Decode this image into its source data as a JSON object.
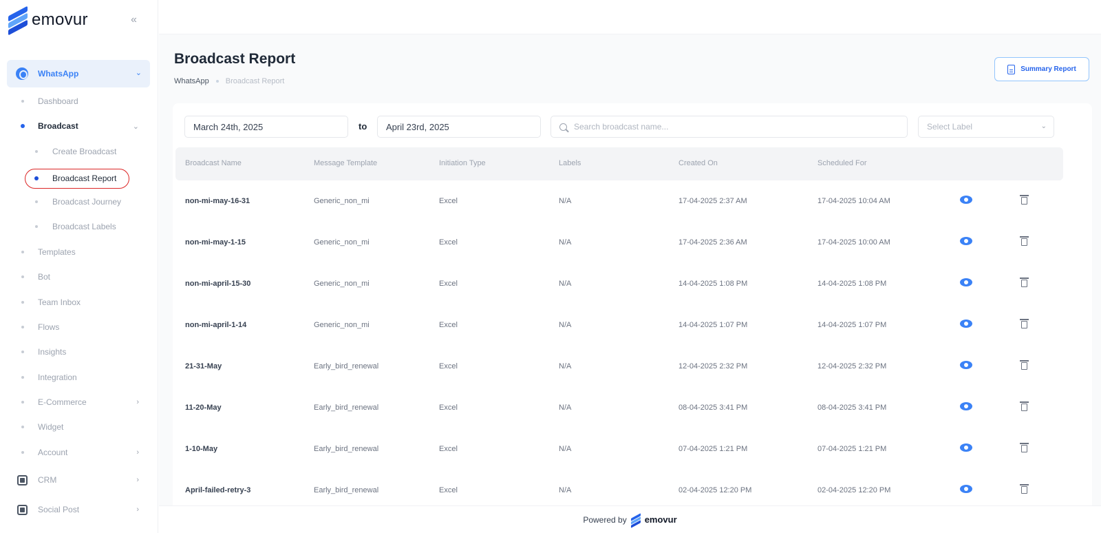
{
  "brand": {
    "name": "emovur"
  },
  "sidebar": {
    "group": {
      "label": "WhatsApp",
      "icon": "whatsapp-icon"
    },
    "items": [
      {
        "label": "Dashboard"
      },
      {
        "label": "Broadcast"
      },
      {
        "label": "Create Broadcast"
      },
      {
        "label": "Broadcast Report"
      },
      {
        "label": "Broadcast Journey"
      },
      {
        "label": "Broadcast Labels"
      },
      {
        "label": "Templates"
      },
      {
        "label": "Bot"
      },
      {
        "label": "Team Inbox"
      },
      {
        "label": "Flows"
      },
      {
        "label": "Insights"
      },
      {
        "label": "Integration"
      },
      {
        "label": "E-Commerce"
      },
      {
        "label": "Widget"
      },
      {
        "label": "Account"
      },
      {
        "label": "CRM"
      },
      {
        "label": "Social Post"
      }
    ],
    "active_item": "Broadcast Report"
  },
  "header": {
    "title": "Broadcast Report",
    "breadcrumb": [
      "WhatsApp",
      "Broadcast Report"
    ],
    "summary_button": "Summary Report"
  },
  "filters": {
    "date_from": "March 24th, 2025",
    "to_label": "to",
    "date_to": "April 23rd, 2025",
    "search_placeholder": "Search broadcast name...",
    "label_placeholder": "Select Label"
  },
  "table": {
    "columns": [
      "Broadcast Name",
      "Message Template",
      "Initiation Type",
      "Labels",
      "Created On",
      "Scheduled For"
    ],
    "rows": [
      [
        "non-mi-may-16-31",
        "Generic_non_mi",
        "Excel",
        "N/A",
        "17-04-2025 2:37 AM",
        "17-04-2025 10:04 AM"
      ],
      [
        "non-mi-may-1-15",
        "Generic_non_mi",
        "Excel",
        "N/A",
        "17-04-2025 2:36 AM",
        "17-04-2025 10:00 AM"
      ],
      [
        "non-mi-april-15-30",
        "Generic_non_mi",
        "Excel",
        "N/A",
        "14-04-2025 1:08 PM",
        "14-04-2025 1:08 PM"
      ],
      [
        "non-mi-april-1-14",
        "Generic_non_mi",
        "Excel",
        "N/A",
        "14-04-2025 1:07 PM",
        "14-04-2025 1:07 PM"
      ],
      [
        "21-31-May",
        "Early_bird_renewal",
        "Excel",
        "N/A",
        "12-04-2025 2:32 PM",
        "12-04-2025 2:32 PM"
      ],
      [
        "11-20-May",
        "Early_bird_renewal",
        "Excel",
        "N/A",
        "08-04-2025 3:41 PM",
        "08-04-2025 3:41 PM"
      ],
      [
        "1-10-May",
        "Early_bird_renewal",
        "Excel",
        "N/A",
        "07-04-2025 1:21 PM",
        "07-04-2025 1:21 PM"
      ],
      [
        "April-failed-retry-3",
        "Early_bird_renewal",
        "Excel",
        "N/A",
        "02-04-2025 12:20 PM",
        "02-04-2025 12:20 PM"
      ]
    ]
  },
  "footer": {
    "powered_by": "Powered by",
    "brand": "emovur"
  },
  "colors": {
    "accent": "#3b82f6",
    "highlight_ring": "#dc2626"
  }
}
